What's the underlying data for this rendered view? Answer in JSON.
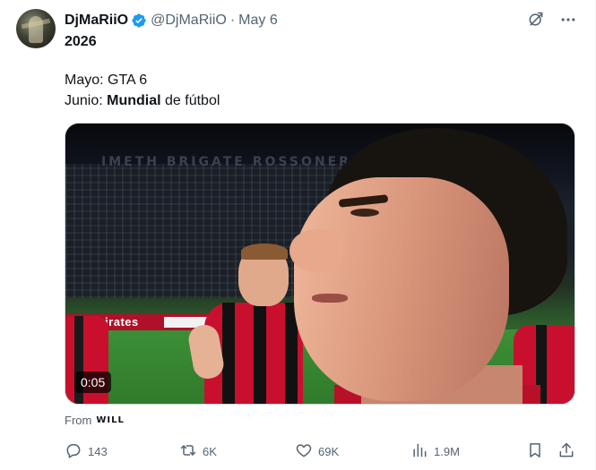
{
  "author": {
    "display_name": "DjMaRiiO",
    "handle": "@DjMaRiiO",
    "separator": "·",
    "date": "May 6",
    "verified": true
  },
  "tweet": {
    "line1": "2026",
    "line2_prefix": "Mayo: ",
    "line2_rest": "GTA 6",
    "line3_prefix": "Junio: ",
    "line3_bold": "Mundial",
    "line3_rest": " de fútbol"
  },
  "media": {
    "type": "video",
    "duration": "0:05",
    "banner_text": "IMETH BRIGATE ROSSONERE",
    "adboard_text": "mirates"
  },
  "source": {
    "prefix": "From",
    "brand": "WILL"
  },
  "actions": {
    "replies": "143",
    "reposts": "6K",
    "likes": "69K",
    "views": "1.9M"
  },
  "icons": {
    "verified": "verified-badge-icon",
    "grok": "grok-icon",
    "more": "more-horizontal-icon",
    "reply": "reply-icon",
    "repost": "repost-icon",
    "like": "heart-icon",
    "views": "views-bar-chart-icon",
    "bookmark": "bookmark-icon",
    "share": "share-icon"
  },
  "colors": {
    "text_primary": "#0f1419",
    "text_secondary": "#536471",
    "verified_blue": "#1d9bf0",
    "divider": "#eff3f4"
  }
}
